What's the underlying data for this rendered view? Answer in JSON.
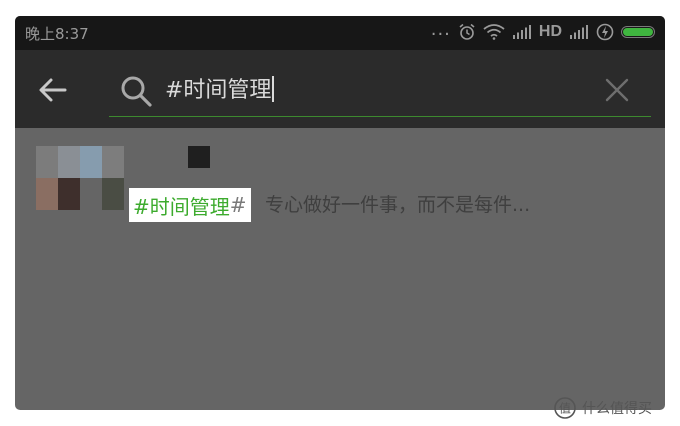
{
  "status_bar": {
    "time": "晚上8:37",
    "dots": "...",
    "network_label": "HD",
    "icons": [
      "alarm-icon",
      "wifi-icon",
      "signal-icon",
      "hd-signal-icon",
      "charging-icon",
      "battery-icon"
    ]
  },
  "search": {
    "query": "#时间管理",
    "back_icon": "arrow-left-icon",
    "search_icon": "magnifier-icon",
    "clear_icon": "close-icon"
  },
  "result": {
    "tag_highlight": "#时间管理",
    "tag_suffix": "#",
    "snippet": "专心做好一件事，而不是每件...",
    "avatar_colors": [
      "#7c7c7c",
      "#8a8f95",
      "#869cae",
      "#7d7d7d",
      "#8a6e62",
      "#3e2f2c",
      "#656565",
      "#4a4d44"
    ]
  },
  "colors": {
    "accent_green": "#3dab2e",
    "header_bg": "#2b2b2b",
    "statusbar_bg": "#171717",
    "content_bg": "#656565"
  },
  "watermark": {
    "text": "什么值得买"
  }
}
